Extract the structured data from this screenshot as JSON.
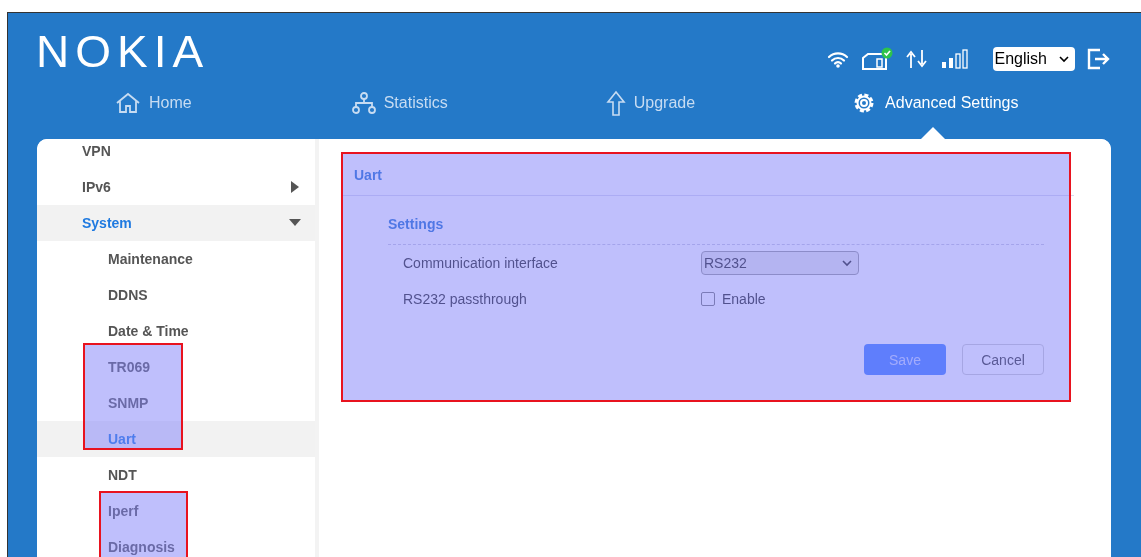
{
  "header": {
    "logo": "NOKIA",
    "language": "English"
  },
  "nav": [
    {
      "label": "Home",
      "selected": false
    },
    {
      "label": "Statistics",
      "selected": false
    },
    {
      "label": "Upgrade",
      "selected": false
    },
    {
      "label": "Advanced Settings",
      "selected": true
    }
  ],
  "sidebar": {
    "items": [
      {
        "label": "VPN",
        "selected": false
      },
      {
        "label": "IPv6",
        "selected": false,
        "expanded": false
      },
      {
        "label": "System",
        "selected": true,
        "expanded": true,
        "children": [
          {
            "label": "Maintenance",
            "selected": false
          },
          {
            "label": "DDNS",
            "selected": false
          },
          {
            "label": "Date & Time",
            "selected": false
          },
          {
            "label": "TR069",
            "selected": false
          },
          {
            "label": "SNMP",
            "selected": false
          },
          {
            "label": "Uart",
            "selected": true
          },
          {
            "label": "NDT",
            "selected": false
          },
          {
            "label": "Iperf",
            "selected": false
          },
          {
            "label": "Diagnosis",
            "selected": false
          }
        ]
      }
    ]
  },
  "panel": {
    "title": "Uart",
    "section": "Settings",
    "fields": [
      {
        "kind": "select",
        "label": "Communication interface",
        "value": "RS232"
      },
      {
        "kind": "checkbox",
        "label": "RS232 passthrough",
        "option": "Enable",
        "checked": false
      }
    ],
    "buttons": [
      {
        "label": "Save",
        "kind": "primary"
      },
      {
        "label": "Cancel",
        "kind": "secondary"
      }
    ]
  }
}
